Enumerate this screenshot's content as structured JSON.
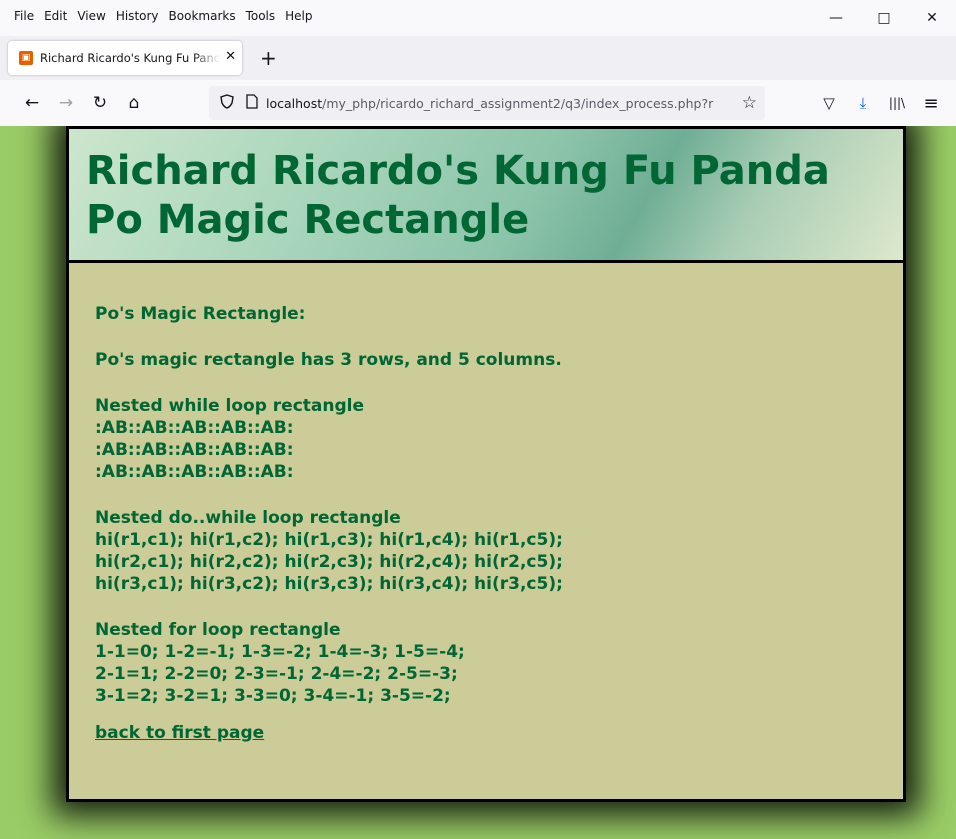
{
  "menu": [
    "File",
    "Edit",
    "View",
    "History",
    "Bookmarks",
    "Tools",
    "Help"
  ],
  "window": {
    "minimize": "—",
    "maximize": "□",
    "close": "✕"
  },
  "tab": {
    "favicon": "▣",
    "title": "Richard Ricardo's Kung Fu Panda Po Magic Rectangle",
    "close": "✕",
    "new_tab": "+"
  },
  "nav": {
    "back": "←",
    "forward": "→",
    "reload": "↻",
    "home": "⌂"
  },
  "url": {
    "host": "localhost",
    "path": "/my_php/ricardo_richard_assignment2/q3/index_process.php?r",
    "star": "☆"
  },
  "tools": {
    "pocket": "▽",
    "download": "⤓",
    "library": "|||\\",
    "menu": "≡"
  },
  "page": {
    "title_line1": "Richard Ricardo's Kung Fu Panda",
    "title_line2": "Po Magic Rectangle",
    "heading": "Po's Magic Rectangle:",
    "summary": "Po's magic rectangle has 3 rows, and 5 columns.",
    "while_title": "Nested while loop rectangle",
    "while_rows": [
      ":AB::AB::AB::AB::AB:",
      ":AB::AB::AB::AB::AB:",
      ":AB::AB::AB::AB::AB:"
    ],
    "dowhile_title": "Nested do..while loop rectangle",
    "dowhile_rows": [
      "hi(r1,c1); hi(r1,c2); hi(r1,c3); hi(r1,c4); hi(r1,c5);",
      "hi(r2,c1); hi(r2,c2); hi(r2,c3); hi(r2,c4); hi(r2,c5);",
      "hi(r3,c1); hi(r3,c2); hi(r3,c3); hi(r3,c4); hi(r3,c5);"
    ],
    "for_title": "Nested for loop rectangle",
    "for_rows": [
      "1-1=0; 1-2=-1; 1-3=-2; 1-4=-3; 1-5=-4;",
      "2-1=1; 2-2=0; 2-3=-1; 2-4=-2; 2-5=-3;",
      "3-1=2; 3-2=1; 3-3=0; 3-4=-1; 3-5=-2;"
    ],
    "back_link": "back to first page"
  }
}
